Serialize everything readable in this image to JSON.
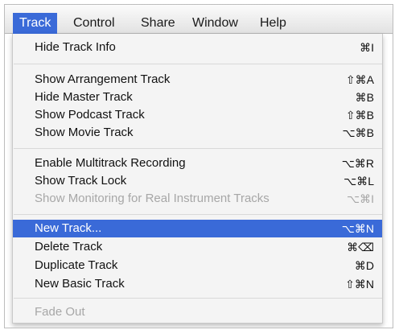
{
  "menubar": {
    "items": [
      {
        "label": "Track"
      },
      {
        "label": "Control"
      },
      {
        "label": "Share"
      },
      {
        "label": "Window"
      },
      {
        "label": "Help"
      }
    ],
    "active_item": "Track"
  },
  "menu": {
    "items": [
      {
        "label": "Hide Track Info",
        "shortcut": "⌘I",
        "enabled": true
      },
      {
        "label": "Show Arrangement Track",
        "shortcut": "⇧⌘A",
        "enabled": true
      },
      {
        "label": "Hide Master Track",
        "shortcut": "⌘B",
        "enabled": true
      },
      {
        "label": "Show Podcast Track",
        "shortcut": "⇧⌘B",
        "enabled": true
      },
      {
        "label": "Show Movie Track",
        "shortcut": "⌥⌘B",
        "enabled": true
      },
      {
        "label": "Enable Multitrack Recording",
        "shortcut": "⌥⌘R",
        "enabled": true
      },
      {
        "label": "Show Track Lock",
        "shortcut": "⌥⌘L",
        "enabled": true
      },
      {
        "label": "Show Monitoring for Real Instrument Tracks",
        "shortcut": "⌥⌘I",
        "enabled": false
      },
      {
        "label": "New Track...",
        "shortcut": "⌥⌘N",
        "enabled": true,
        "highlighted": true
      },
      {
        "label": "Delete Track",
        "shortcut": "⌘⌫",
        "enabled": true
      },
      {
        "label": "Duplicate Track",
        "shortcut": "⌘D",
        "enabled": true
      },
      {
        "label": "New Basic Track",
        "shortcut": "⇧⌘N",
        "enabled": true
      },
      {
        "label": "Fade Out",
        "shortcut": "",
        "enabled": false
      }
    ]
  },
  "colors": {
    "highlight": "#3a6ad8",
    "disabled_text": "#a7a7a7",
    "text": "#111111"
  }
}
